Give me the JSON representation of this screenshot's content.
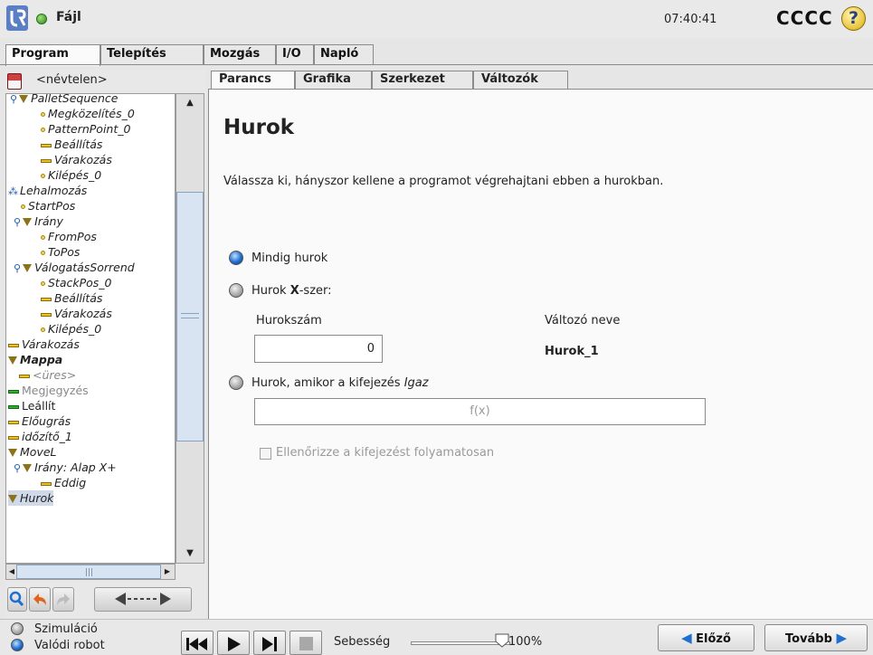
{
  "header": {
    "file_menu": "Fájl",
    "clock": "07:40:41",
    "robot_name": "CCCC",
    "help_glyph": "?"
  },
  "main_tabs": [
    "Program",
    "Telepítés",
    "Mozgás",
    "I/O",
    "Napló"
  ],
  "left": {
    "program_name": "<névtelen>",
    "tree": [
      "PalletSequence",
      "Megközelítés_0",
      "PatternPoint_0",
      "Beállítás",
      "Várakozás",
      "Kilépés_0",
      "Lehalmozás",
      "StartPos",
      "Irány",
      "FromPos",
      "ToPos",
      "VálogatásSorrend",
      "StackPos_0",
      "Beállítás",
      "Várakozás",
      "Kilépés_0",
      "Várakozás",
      "Mappa",
      "<üres>",
      "Megjegyzés",
      "Leállít",
      "Előugrás",
      "időzítő_1",
      "MoveL",
      "Irány: Alap X+",
      "Eddig",
      "Hurok"
    ]
  },
  "sub_tabs": [
    "Parancs",
    "Grafika",
    "Szerkezet",
    "Változók"
  ],
  "content": {
    "title": "Hurok",
    "description": "Válassza ki, hányszor kellene a programot végrehajtani ebben a hurokban.",
    "option_always": "Mindig hurok",
    "option_times_prefix": "Hurok ",
    "option_times_x": "X",
    "option_times_suffix": "-szer:",
    "loop_count_label": "Hurokszám",
    "loop_count_value": "0",
    "var_name_label": "Változó neve",
    "var_name_value": "Hurok_1",
    "option_expr_prefix": "Hurok, amikor a kifejezés ",
    "option_expr_italic": "Igaz",
    "expr_placeholder": "f(x)",
    "check_label": "Ellenőrizze a kifejezést folyamatosan"
  },
  "bottom": {
    "mode_sim": "Szimuláció",
    "mode_real": "Valódi robot",
    "speed_label": "Sebesség",
    "speed_value": "100%",
    "speed_fraction": 1.0,
    "prev": "Előző",
    "next": "Tovább"
  },
  "icons": [
    "ur-logo-icon",
    "status-dot-icon",
    "help-icon",
    "save-icon",
    "search-icon",
    "undo-icon",
    "redo-icon",
    "move-arrows-icon",
    "skip-back-icon",
    "play-icon",
    "step-icon",
    "stop-icon",
    "arrow-left-icon",
    "arrow-right-icon"
  ],
  "colors": {
    "accent_blue": "#1f6fd0",
    "status_green": "#2e8a1e",
    "help_yellow": "#e8c23a"
  }
}
